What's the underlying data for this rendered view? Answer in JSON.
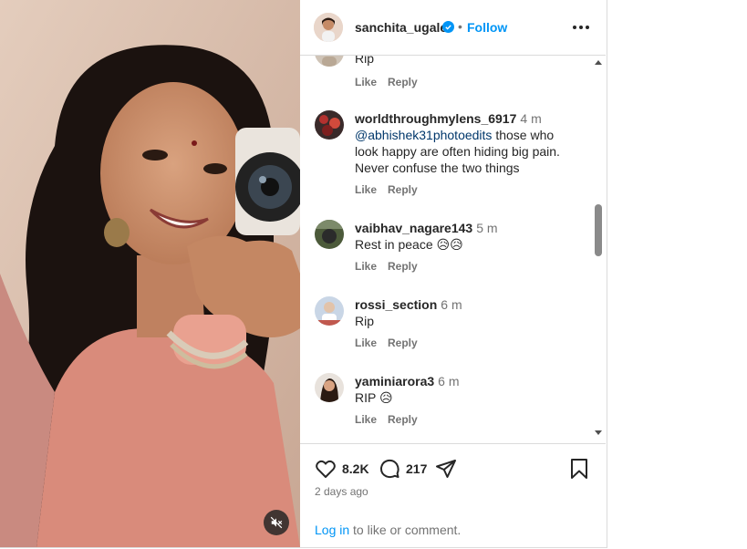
{
  "post": {
    "username": "sanchita_ugale",
    "separator": "•",
    "follow_label": "Follow",
    "likes": "8.2K",
    "comments_count": "217",
    "time_ago": "2 days ago",
    "login_link": "Log in",
    "login_suffix": " to like or comment."
  },
  "comments": [
    {
      "user": "",
      "time": "",
      "text": "Rip",
      "like_label": "Like",
      "reply_label": "Reply"
    },
    {
      "user": "worldthroughmylens_6917",
      "time": "4 m",
      "mention": "@abhishek31photoedits",
      "text": " those who look happy are often hiding big pain. Never confuse the two things",
      "like_label": "Like",
      "reply_label": "Reply"
    },
    {
      "user": "vaibhav_nagare143",
      "time": "5 m",
      "text": "Rest in peace 😥😥",
      "like_label": "Like",
      "reply_label": "Reply"
    },
    {
      "user": "rossi_section",
      "time": "6 m",
      "text": "Rip",
      "like_label": "Like",
      "reply_label": "Reply"
    },
    {
      "user": "yaminiarora3",
      "time": "6 m",
      "text": "RIP 😥",
      "like_label": "Like",
      "reply_label": "Reply"
    }
  ],
  "icons": {
    "like": "heart-icon",
    "comment": "comment-bubble-icon",
    "share": "share-send-icon",
    "save": "bookmark-icon",
    "more": "more-options-icon",
    "mute": "muted-speaker-icon",
    "verified": "verified-badge-icon"
  },
  "colors": {
    "accent": "#0095f6",
    "verified": "#0095f6",
    "mention": "#00376b",
    "secondary_text": "#737373",
    "border": "#dbdbdb"
  }
}
